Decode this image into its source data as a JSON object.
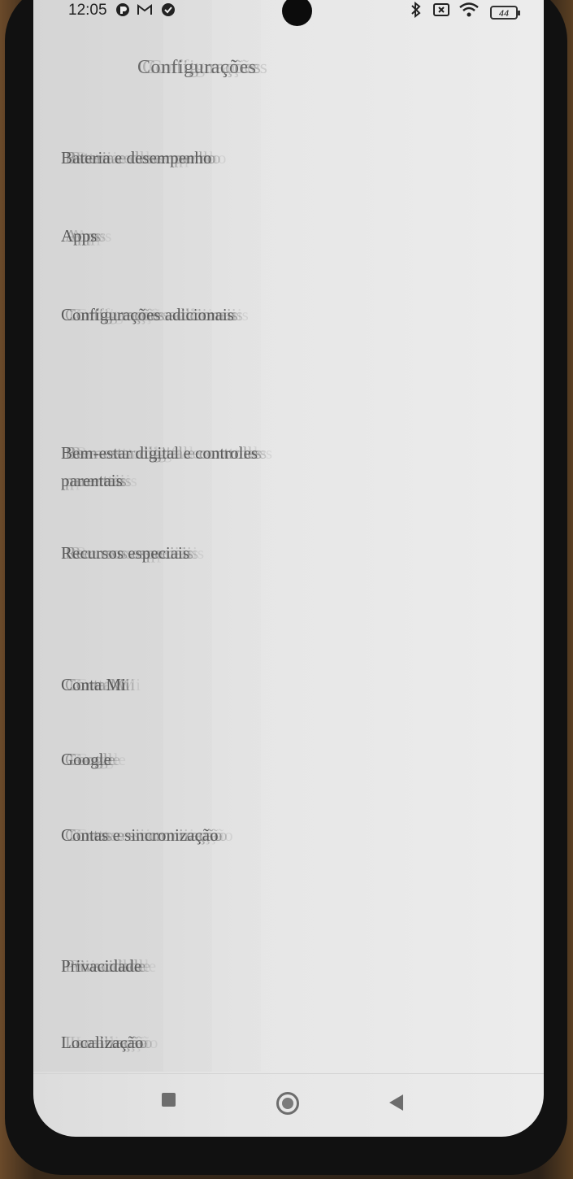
{
  "status_bar": {
    "time": "12:05",
    "battery": "44",
    "left_icons": [
      "app-notification-icon",
      "gmail-icon",
      "check-circle-icon"
    ],
    "right_icons": [
      "bluetooth-icon",
      "no-sim-icon",
      "wifi-icon",
      "battery-icon"
    ]
  },
  "header": {
    "title": "Configurações"
  },
  "settings_items": [
    {
      "label": "Bateria e desempenho"
    },
    {
      "label": "Apps"
    },
    {
      "label": "Configurações adicionais"
    },
    {
      "label": "Bem-estar digital e controles parentais"
    },
    {
      "label": "Recursos especiais"
    },
    {
      "label": "Conta Mi"
    },
    {
      "label": "Google"
    },
    {
      "label": "Contas e sincronização"
    },
    {
      "label": "Privacidade"
    },
    {
      "label": "Localização"
    }
  ],
  "nav_bar": {
    "buttons": [
      "recents-button",
      "home-button",
      "back-button"
    ]
  }
}
